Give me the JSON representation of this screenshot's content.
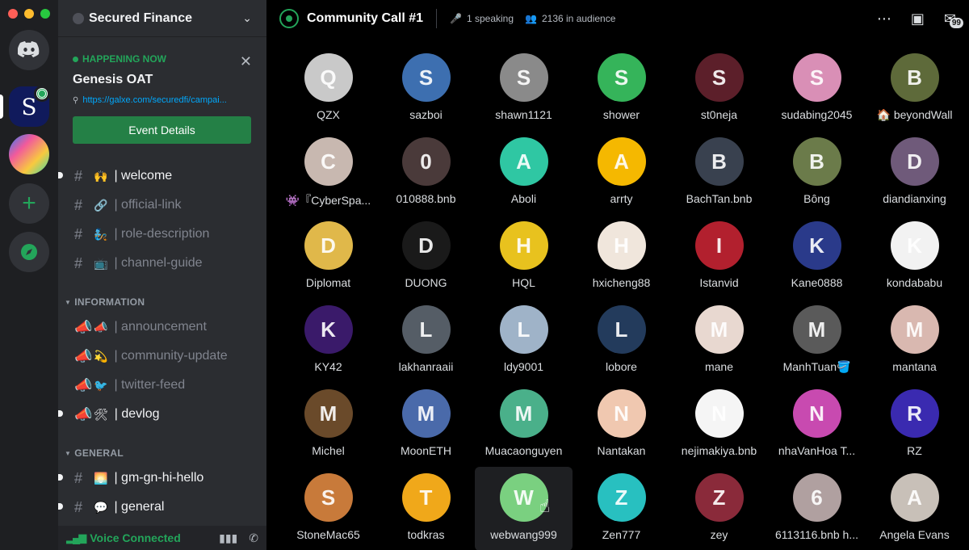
{
  "rail": {
    "servers": [
      {
        "name": "Discord Home",
        "glyph": "🎮"
      },
      {
        "name": "Secured Finance",
        "glyph": "S"
      },
      {
        "name": "Galxe",
        "glyph": "◈"
      },
      {
        "name": "Add a Server",
        "glyph": "+"
      },
      {
        "name": "Explore",
        "glyph": "➤"
      }
    ]
  },
  "sidebar": {
    "server_name": "Secured Finance",
    "event": {
      "status": "HAPPENING NOW",
      "title": "Genesis OAT",
      "link": "https://galxe.com/securedfi/campai...",
      "button": "Event Details"
    },
    "channels_top": [
      {
        "emoji": "🙌",
        "name": "| welcome",
        "unread": true
      },
      {
        "emoji": "🔗",
        "name": "| official-link",
        "unread": false
      },
      {
        "emoji": "🧞",
        "name": "| role-description",
        "unread": false
      },
      {
        "emoji": "📺",
        "name": "| channel-guide",
        "unread": false
      }
    ],
    "category_information": "INFORMATION",
    "channels_info": [
      {
        "emoji": "📣",
        "name": "| announcement",
        "unread": false
      },
      {
        "emoji": "💫",
        "name": "| community-update",
        "unread": false
      },
      {
        "emoji": "🐦",
        "name": "| twitter-feed",
        "unread": false
      },
      {
        "emoji": "🛠",
        "name": "| devlog",
        "unread": true
      }
    ],
    "category_general": "GENERAL",
    "channels_general": [
      {
        "emoji": "🌅",
        "name": "| gm-gn-hi-hello",
        "unread": true
      },
      {
        "emoji": "💬",
        "name": "| general",
        "unread": true
      }
    ],
    "voice_status": "Voice Connected"
  },
  "stage": {
    "title": "Community Call #1",
    "speaking": "1 speaking",
    "audience": "2136 in audience",
    "inbox_badge": "99"
  },
  "audience": [
    {
      "name": "QZX",
      "color": "#c9c9c9",
      "glyph": "Q"
    },
    {
      "name": "sazboi",
      "color": "#3d6fb0",
      "glyph": "S"
    },
    {
      "name": "shawn1121",
      "color": "#8a8a8a",
      "glyph": "S"
    },
    {
      "name": "shower",
      "color": "#35b45a",
      "glyph": "S"
    },
    {
      "name": "st0neja",
      "color": "#5c1f2a",
      "glyph": "S"
    },
    {
      "name": "sudabing2045",
      "color": "#d98fb6",
      "glyph": "S"
    },
    {
      "name": "🏠 beyondWall",
      "color": "#5e6a3a",
      "glyph": "B"
    },
    {
      "name": "👾『CyberSpa...",
      "color": "#c8b8b0",
      "glyph": "C"
    },
    {
      "name": "010888.bnb",
      "color": "#4a3a3a",
      "glyph": "0"
    },
    {
      "name": "Aboli",
      "color": "#2fc7a3",
      "glyph": "A"
    },
    {
      "name": "arrty",
      "color": "#f5b800",
      "glyph": "A"
    },
    {
      "name": "BachTan.bnb",
      "color": "#39414f",
      "glyph": "B"
    },
    {
      "name": "Bông",
      "color": "#6b7b4a",
      "glyph": "B"
    },
    {
      "name": "diandianxing",
      "color": "#6f5a7a",
      "glyph": "D"
    },
    {
      "name": "Diplomat",
      "color": "#e0b84a",
      "glyph": "D"
    },
    {
      "name": "DUONG",
      "color": "#1a1a1a",
      "glyph": "D"
    },
    {
      "name": "HQL",
      "color": "#e8c21e",
      "glyph": "H"
    },
    {
      "name": "hxicheng88",
      "color": "#f0e6dc",
      "glyph": "H"
    },
    {
      "name": "Istanvid",
      "color": "#b2202e",
      "glyph": "I"
    },
    {
      "name": "Kane0888",
      "color": "#2a3a8a",
      "glyph": "K"
    },
    {
      "name": "kondababu",
      "color": "#f2f2f2",
      "glyph": "K"
    },
    {
      "name": "KY42",
      "color": "#3a1a6a",
      "glyph": "K"
    },
    {
      "name": "lakhanraaii",
      "color": "#555d66",
      "glyph": "L"
    },
    {
      "name": "ldy9001",
      "color": "#9fb3c8",
      "glyph": "L"
    },
    {
      "name": "lobore",
      "color": "#233b5c",
      "glyph": "L"
    },
    {
      "name": "mane",
      "color": "#e8d8d0",
      "glyph": "M"
    },
    {
      "name": "ManhTuan🪣",
      "color": "#5a5a5a",
      "glyph": "M"
    },
    {
      "name": "mantana",
      "color": "#d9b8b0",
      "glyph": "M"
    },
    {
      "name": "Michel",
      "color": "#6a4a2a",
      "glyph": "M"
    },
    {
      "name": "MoonETH",
      "color": "#4a6aaa",
      "glyph": "M"
    },
    {
      "name": "Muacaonguyen",
      "color": "#4ab08a",
      "glyph": "M"
    },
    {
      "name": "Nantakan",
      "color": "#f0c8b0",
      "glyph": "N"
    },
    {
      "name": "nejimakiya.bnb",
      "color": "#f5f5f5",
      "glyph": "N"
    },
    {
      "name": "nhaVanHoa T...",
      "color": "#c84ab0",
      "glyph": "N"
    },
    {
      "name": "RZ",
      "color": "#3a2ab0",
      "glyph": "R"
    },
    {
      "name": "StoneMac65",
      "color": "#c87a3a",
      "glyph": "S"
    },
    {
      "name": "todkras",
      "color": "#f0a81a",
      "glyph": "T"
    },
    {
      "name": "webwang999",
      "color": "#7ad080",
      "glyph": "W"
    },
    {
      "name": "Zen777",
      "color": "#28c0c0",
      "glyph": "Z"
    },
    {
      "name": "zey",
      "color": "#8a2a3a",
      "glyph": "Z"
    },
    {
      "name": "6113116.bnb h...",
      "color": "#b0a0a0",
      "glyph": "6"
    },
    {
      "name": "Angela Evans",
      "color": "#c8c0b8",
      "glyph": "A"
    }
  ]
}
